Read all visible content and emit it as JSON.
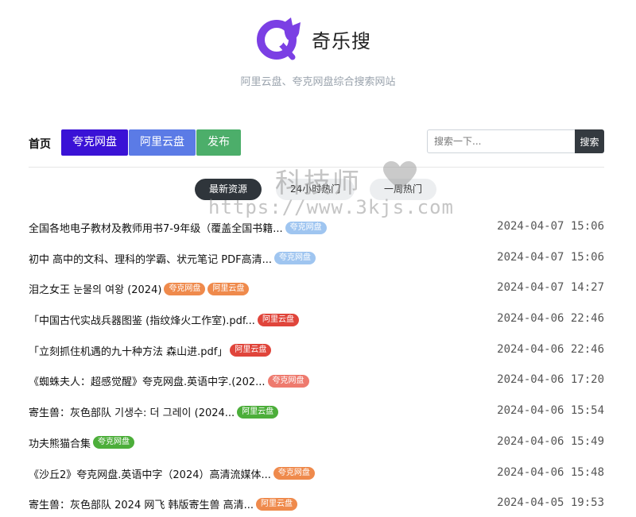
{
  "brand": {
    "name": "奇乐搜",
    "tagline": "阿里云盘、夸克网盘综合搜索网站"
  },
  "nav": {
    "home": "首页",
    "quark": "夸克网盘",
    "aliyun": "阿里云盘",
    "publish": "发布"
  },
  "search": {
    "placeholder": "搜索一下...",
    "value": "",
    "button": "搜索"
  },
  "tabs": [
    "最新资源",
    "24小时热门",
    "一周热门"
  ],
  "watermark": {
    "title": "科技师",
    "url": "https://www.3kjs.com"
  },
  "items": [
    {
      "title": "全国各地电子教材及教师用书7-9年级（覆盖全国书籍...",
      "tags": [
        {
          "label": "夸克网盘",
          "color": "quark-blue"
        }
      ],
      "time": "2024-04-07 15:06"
    },
    {
      "title": "初中 高中的文科、理科的学霸、状元笔记 PDF高清...",
      "tags": [
        {
          "label": "夸克网盘",
          "color": "quark-blue"
        }
      ],
      "time": "2024-04-07 15:06"
    },
    {
      "title": "泪之女王 눈물의 여왕 (2024)",
      "tags": [
        {
          "label": "夸克网盘",
          "color": "orange"
        },
        {
          "label": "阿里云盘",
          "color": "orange"
        }
      ],
      "time": "2024-04-07 14:27"
    },
    {
      "title": "「中国古代实战兵器图鉴 (指纹烽火工作室).pdf...",
      "tags": [
        {
          "label": "阿里云盘",
          "color": "red"
        }
      ],
      "time": "2024-04-06 22:46"
    },
    {
      "title": "「立刻抓住机遇的九十种方法 森山进.pdf」",
      "tags": [
        {
          "label": "阿里云盘",
          "color": "red"
        }
      ],
      "time": "2024-04-06 22:46"
    },
    {
      "title": "《蜘蛛夫人：超感觉醒》夸克网盘.英语中字.(202...",
      "tags": [
        {
          "label": "夸克网盘",
          "color": "salmon"
        }
      ],
      "time": "2024-04-06 17:20"
    },
    {
      "title": "寄生兽：灰色部队 기생수: 더 그레이 (2024...",
      "tags": [
        {
          "label": "阿里云盘",
          "color": "green"
        }
      ],
      "time": "2024-04-06 15:54"
    },
    {
      "title": "功夫熊猫合集",
      "tags": [
        {
          "label": "夸克网盘",
          "color": "green"
        }
      ],
      "time": "2024-04-06 15:49"
    },
    {
      "title": "《沙丘2》夸克网盘.英语中字（2024）高清流媒体...",
      "tags": [
        {
          "label": "夸克网盘",
          "color": "orange"
        }
      ],
      "time": "2024-04-06 15:48"
    },
    {
      "title": "寄生兽：灰色部队 2024 网飞 韩版寄生兽 高清...",
      "tags": [
        {
          "label": "阿里云盘",
          "color": "orange"
        }
      ],
      "time": "2024-04-05 19:53"
    }
  ],
  "colors": {
    "quark_primary": "#3a12d6",
    "aliyun_primary": "#5b7be6",
    "publish": "#4cae6a",
    "logo": "#7b3fe4"
  }
}
